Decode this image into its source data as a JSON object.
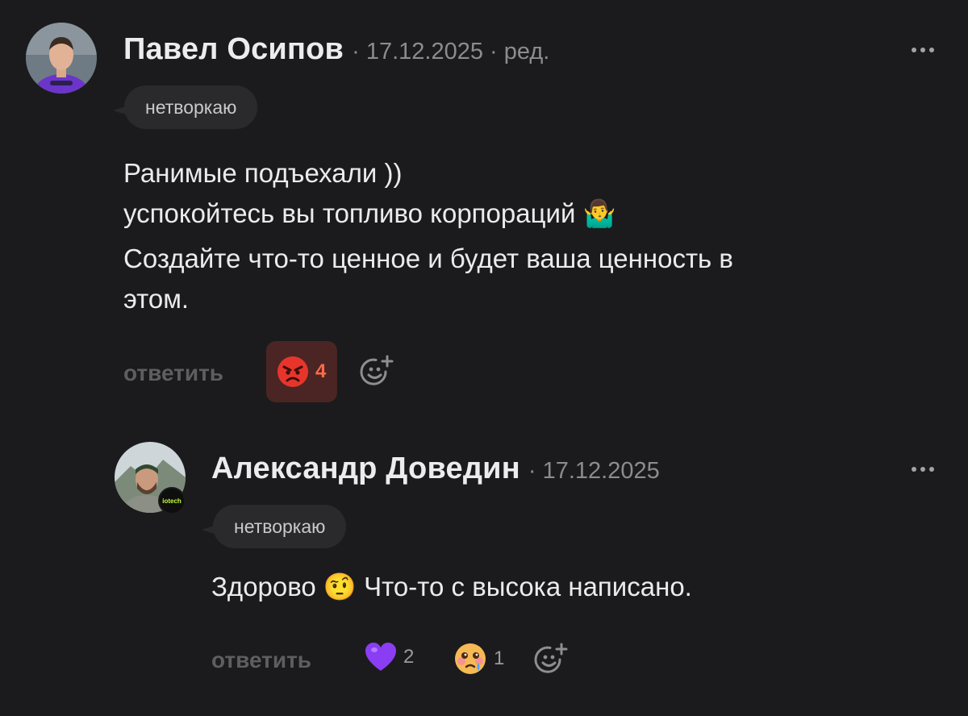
{
  "comments": [
    {
      "author": "Павел Осипов",
      "meta": "· 17.12.2025 · ред.",
      "tag": "нетворкаю",
      "text_lines": [
        "Ранимые подъехали ))",
        "успокойтесь вы топливо корпораций 🤷‍♂️",
        "Создайте что-то ценное и будет ваша ценность в",
        "этом."
      ],
      "reply_label": "ответить",
      "reactions": [
        {
          "icon": "angry-face-icon",
          "count": "4",
          "active": true
        }
      ]
    },
    {
      "author": "Александр Доведин",
      "meta": "· 17.12.2025",
      "tag": "нетворкаю",
      "text": "Здорово 🤨 Что-то с высока написано.",
      "reply_label": "ответить",
      "avatar_badge": "iotech",
      "reactions": [
        {
          "icon": "purple-heart-icon",
          "count": "2"
        },
        {
          "icon": "tearful-face-icon",
          "count": "1"
        }
      ]
    }
  ],
  "colors": {
    "background": "#1b1b1d",
    "tag_background": "#2a2a2d",
    "active_reaction_background": "#4a2523",
    "active_count": "#ff6a4a",
    "purple_heart": "#8a3df2"
  }
}
